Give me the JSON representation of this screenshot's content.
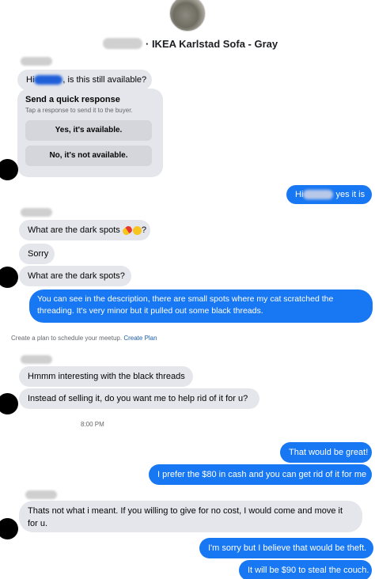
{
  "header": {
    "listing_title": "· IKEA Karlstad Sofa - Gray"
  },
  "first_message": {
    "greeting": "Hi",
    "rest": ", is this still available?"
  },
  "quick_response": {
    "title": "Send a quick response",
    "subtitle": "Tap a response to send it to the buyer.",
    "options": [
      "Yes, it's available.",
      "No, it's not available."
    ]
  },
  "messages": {
    "m_yes_hi": "Hi",
    "m_yes_rest": "yes it is",
    "m_dark_spots_emoji": "What are the dark spots",
    "m_dark_spots_q": "?",
    "m_sorry": "Sorry",
    "m_dark_spots": "What are the dark spots?",
    "m_description": "You can see in the description, there are small spots where my cat scratched the threading. It's very minor but it pulled out some black threads.",
    "m_hmmm": "Hmmm interesting with the black threads",
    "m_instead": "Instead of selling it, do you want me to help rid of it for u?",
    "m_great": "That would be great!",
    "m_cash": "I prefer the $80 in cash and you can get rid of it for me",
    "m_not_meant": "Thats not what i meant. If you willing to give for no cost, I would come and move it for u.",
    "m_theft": "I'm sorry but I believe that would be theft.",
    "m_steal": "It will be $90 to steal the couch."
  },
  "system": {
    "plan_text": "Create a plan to schedule your meetup.",
    "plan_link": "Create Plan",
    "timestamp": "8:00 PM"
  },
  "colors": {
    "outgoing_bubble": "#1877f2",
    "incoming_bubble": "#e4e6eb"
  }
}
